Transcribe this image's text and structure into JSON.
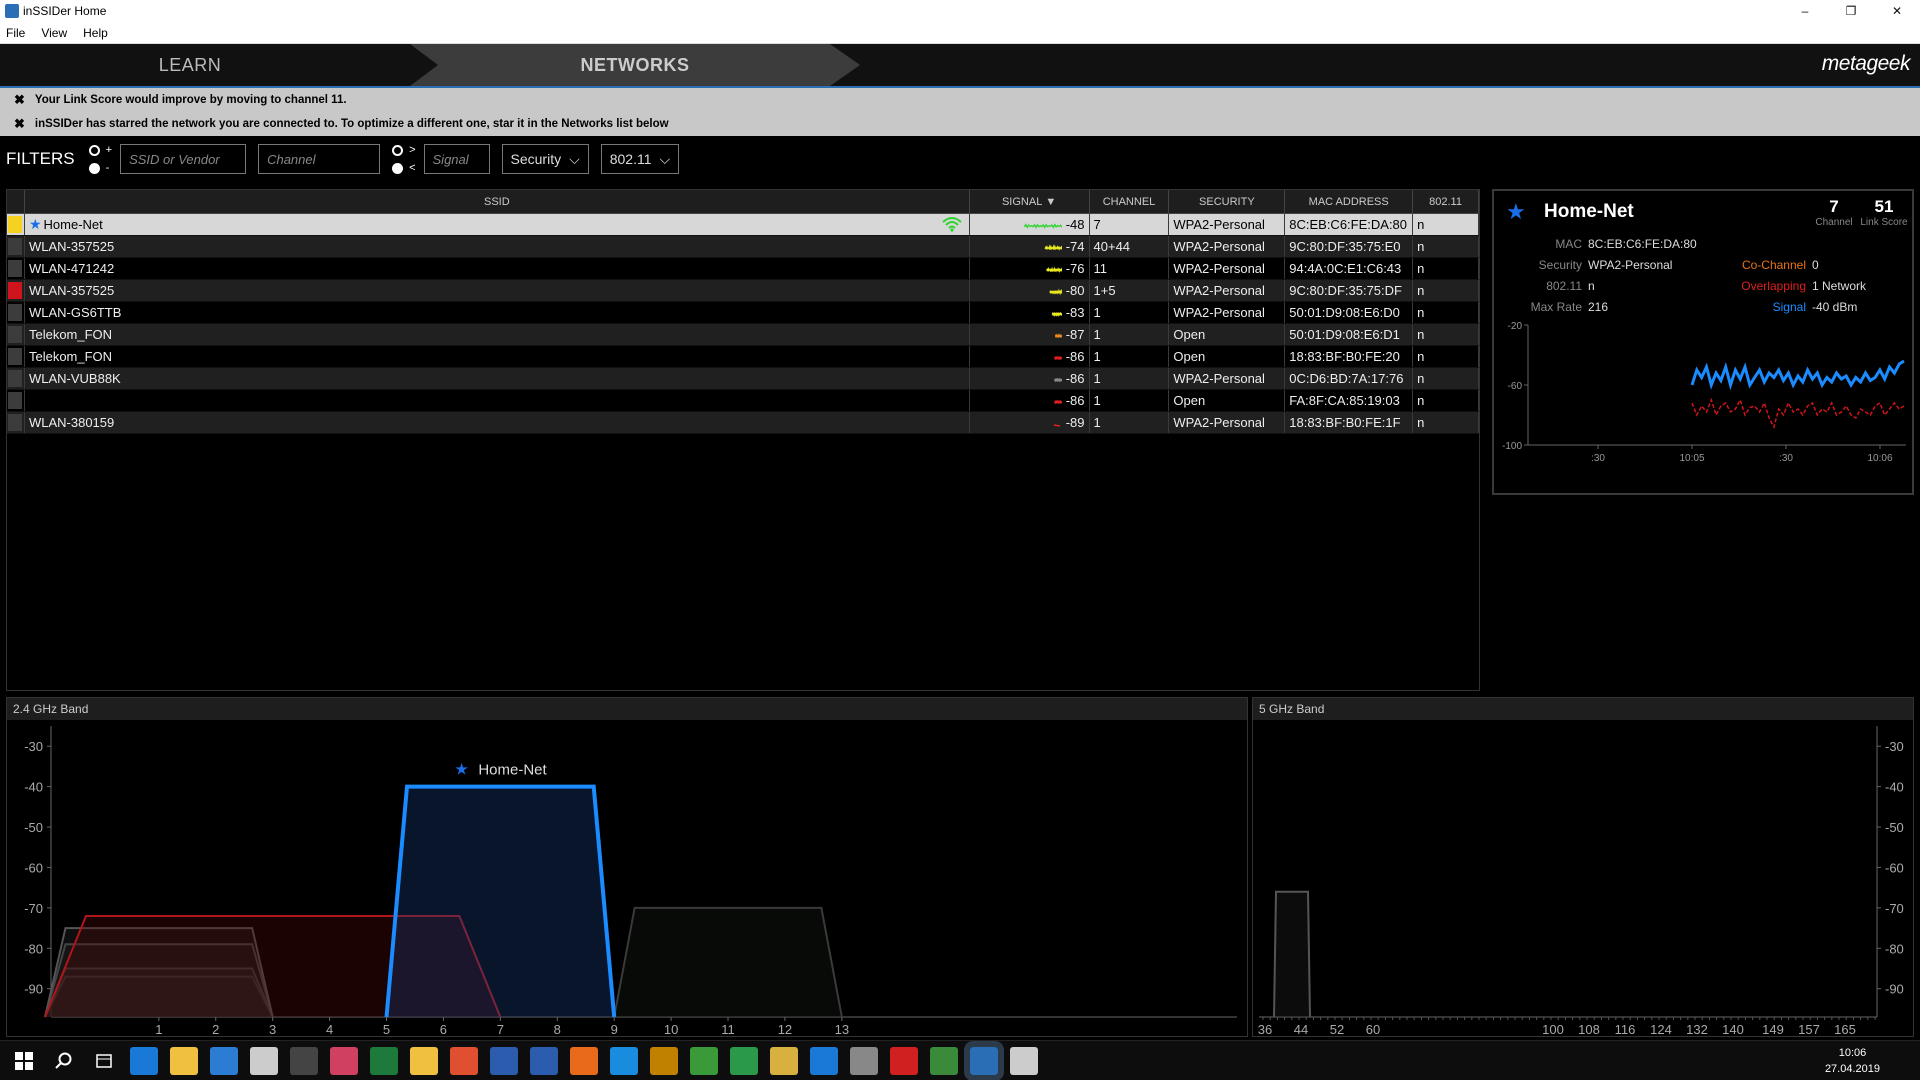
{
  "window": {
    "title": "inSSIDer Home",
    "controls": {
      "minimize": "–",
      "restore": "❐",
      "close": "✕"
    }
  },
  "menu": {
    "items": [
      "File",
      "View",
      "Help"
    ]
  },
  "nav": {
    "learn_label": "LEARN",
    "networks_label": "NETWORKS",
    "logo_text": "metageek"
  },
  "messages": [
    "Your Link Score would improve by moving to channel 11.",
    "inSSIDer has starred the network you are connected to. To optimize a different one, star it in the Networks list below"
  ],
  "filters": {
    "label": "FILTERS",
    "ssid_placeholder": "SSID or Vendor",
    "channel_placeholder": "Channel",
    "signal_placeholder": "Signal",
    "security_label": "Security",
    "standard_label": "802.11",
    "plus": "+",
    "minus": "-",
    "gt": ">",
    "lt": "<"
  },
  "table": {
    "headers": {
      "ssid": "SSID",
      "signal": "SIGNAL",
      "channel": "CHANNEL",
      "security": "SECURITY",
      "mac": "MAC ADDRESS",
      "standard": "802.11"
    },
    "rows": [
      {
        "color": "#f4d21f",
        "ssid": "Home-Net",
        "starred": true,
        "signal": "-48",
        "channel": "7",
        "security": "WPA2-Personal",
        "mac": "8C:EB:C6:FE:DA:80",
        "standard": "n",
        "spark_color": "#2bd42b"
      },
      {
        "color": "#3c3c3c",
        "ssid": "WLAN-357525",
        "starred": false,
        "signal": "-74",
        "channel": "40+44",
        "security": "WPA2-Personal",
        "mac": "9C:80:DF:35:75:E0",
        "standard": "n",
        "spark_color": "#e8e820"
      },
      {
        "color": "#3c3c3c",
        "ssid": "WLAN-471242",
        "starred": false,
        "signal": "-76",
        "channel": "11",
        "security": "WPA2-Personal",
        "mac": "94:4A:0C:E1:C6:43",
        "standard": "n",
        "spark_color": "#e8e820"
      },
      {
        "color": "#d0141c",
        "ssid": "WLAN-357525",
        "starred": false,
        "signal": "-80",
        "channel": "1+5",
        "security": "WPA2-Personal",
        "mac": "9C:80:DF:35:75:DF",
        "standard": "n",
        "spark_color": "#e8e820"
      },
      {
        "color": "#3c3c3c",
        "ssid": "WLAN-GS6TTB",
        "starred": false,
        "signal": "-83",
        "channel": "1",
        "security": "WPA2-Personal",
        "mac": "50:01:D9:08:E6:D0",
        "standard": "n",
        "spark_color": "#e8e820"
      },
      {
        "color": "#3c3c3c",
        "ssid": "Telekom_FON",
        "starred": false,
        "signal": "-87",
        "channel": "1",
        "security": "Open",
        "mac": "50:01:D9:08:E6:D1",
        "standard": "n",
        "spark_color": "#e88a20"
      },
      {
        "color": "#3c3c3c",
        "ssid": "Telekom_FON",
        "starred": false,
        "signal": "-86",
        "channel": "1",
        "security": "Open",
        "mac": "18:83:BF:B0:FE:20",
        "standard": "n",
        "spark_color": "#e02020"
      },
      {
        "color": "#3c3c3c",
        "ssid": "WLAN-VUB88K",
        "starred": false,
        "signal": "-86",
        "channel": "1",
        "security": "WPA2-Personal",
        "mac": "0C:D6:BD:7A:17:76",
        "standard": "n",
        "spark_color": "#888888"
      },
      {
        "color": "#3c3c3c",
        "ssid": "",
        "starred": false,
        "signal": "-86",
        "channel": "1",
        "security": "Open",
        "mac": "FA:8F:CA:85:19:03",
        "standard": "n",
        "spark_color": "#e02020"
      },
      {
        "color": "#3c3c3c",
        "ssid": "WLAN-380159",
        "starred": false,
        "signal": "-89",
        "channel": "1",
        "security": "WPA2-Personal",
        "mac": "18:83:BF:B0:FE:1F",
        "standard": "n",
        "spark_color": "#e02020"
      }
    ]
  },
  "details": {
    "ssid": "Home-Net",
    "channel_value": "7",
    "channel_label": "Channel",
    "link_score_value": "51",
    "link_score_label": "Link Score",
    "mac_label": "MAC",
    "mac_value": "8C:EB:C6:FE:DA:80",
    "security_label": "Security",
    "security_value": "WPA2-Personal",
    "std_label": "802.11",
    "std_value": "n",
    "max_rate_label": "Max Rate",
    "max_rate_value": "216",
    "cochannel_label": "Co-Channel",
    "cochannel_value": "0",
    "overlapping_label": "Overlapping",
    "overlapping_value": "1 Network",
    "signal_label": "Signal",
    "signal_value": "-40 dBm",
    "colors": {
      "cochannel": "#e8741a",
      "overlapping": "#e02020",
      "signal": "#1a8cff"
    }
  },
  "chart_data": [
    {
      "type": "line",
      "title": "",
      "x_ticks": [
        ":30",
        "10:05",
        ":30",
        "10:06"
      ],
      "y_ticks": [
        "-20",
        "-60",
        "-100"
      ],
      "ylim": [
        -100,
        -20
      ],
      "series": [
        {
          "color": "#1a8cff",
          "values": [
            -60,
            -50,
            -55,
            -48,
            -60,
            -52,
            -57,
            -48,
            -60,
            -50,
            -56,
            -48,
            -60,
            -55,
            -50,
            -58,
            -52,
            -55,
            -50,
            -57,
            -52,
            -60,
            -54,
            -58,
            -50,
            -56,
            -52,
            -60,
            -55,
            -58,
            -52,
            -56,
            -54,
            -60,
            -55,
            -58,
            -52,
            -57,
            -55,
            -50,
            -56,
            -48,
            -52,
            -46,
            -44
          ]
        },
        {
          "color": "#d0141c",
          "values": [
            -72,
            -80,
            -74,
            -78,
            -70,
            -80,
            -74,
            -72,
            -78,
            -76,
            -70,
            -80,
            -75,
            -74,
            -78,
            -72,
            -82,
            -88,
            -76,
            -80,
            -72,
            -78,
            -76,
            -80,
            -74,
            -72,
            -80,
            -76,
            -78,
            -72,
            -80,
            -78,
            -74,
            -80,
            -82,
            -76,
            -78,
            -80,
            -74,
            -72,
            -80,
            -76,
            -72,
            -76,
            -74
          ]
        }
      ],
      "grid": false
    },
    {
      "type": "area",
      "title": "2.4 GHz Band",
      "x_ticks": [
        "1",
        "2",
        "3",
        "4",
        "5",
        "6",
        "7",
        "8",
        "9",
        "10",
        "11",
        "12",
        "13"
      ],
      "y_ticks": [
        "-30",
        "-40",
        "-50",
        "-60",
        "-70",
        "-80",
        "-90"
      ],
      "ylim": [
        -97,
        -25
      ],
      "xlim": [
        -1.0,
        16.0
      ],
      "tick_colors": [
        "#d0141c",
        "#888",
        "#888",
        "#d0141c",
        "#d0141c",
        "#888",
        "#d0141c",
        "#888",
        "#1a8cff",
        "#d0141c",
        "#888",
        "#888",
        "#888"
      ],
      "series": [
        {
          "name": "Home-Net",
          "ranges": [
            5,
            9
          ],
          "peak": -40,
          "edge": -97,
          "stroke": "#1a8cff",
          "fill": "rgba(26,60,120,0.35)",
          "width": 4,
          "starred": true
        },
        {
          "ranges": [
            -1,
            7
          ],
          "peak": -72,
          "edge": -97,
          "stroke": "#b0151c",
          "fill": "rgba(80,10,10,0.35)",
          "width": 2
        },
        {
          "ranges": [
            -1,
            3
          ],
          "peak": -75,
          "edge": -97,
          "stroke": "#555",
          "fill": "rgba(40,40,40,0.35)",
          "width": 2
        },
        {
          "ranges": [
            -1,
            3
          ],
          "peak": -79,
          "edge": -97,
          "stroke": "#555",
          "fill": "rgba(40,40,40,0.3)",
          "width": 2
        },
        {
          "ranges": [
            -1,
            3
          ],
          "peak": -85,
          "edge": -97,
          "stroke": "#555",
          "fill": "rgba(40,40,40,0.3)",
          "width": 2
        },
        {
          "ranges": [
            -1,
            3
          ],
          "peak": -87,
          "edge": -97,
          "stroke": "#555",
          "fill": "rgba(40,40,40,0.3)",
          "width": 2
        },
        {
          "ranges": [
            9,
            13
          ],
          "peak": -70,
          "edge": -97,
          "stroke": "#3a3a3a",
          "fill": "rgba(20,30,20,0.35)",
          "width": 2
        }
      ]
    },
    {
      "type": "area",
      "title": "5 GHz Band",
      "x_ticks": [
        "36",
        "44",
        "52",
        "60",
        "100",
        "108",
        "116",
        "124",
        "132",
        "140",
        "149",
        "157",
        "165"
      ],
      "y_ticks": [
        "-30",
        "-40",
        "-50",
        "-60",
        "-70",
        "-80",
        "-90"
      ],
      "ylim": [
        -97,
        -25
      ],
      "series": [
        {
          "ranges": [
            38,
            46
          ],
          "peak": -66,
          "edge": -97,
          "stroke": "#555",
          "fill": "rgba(40,40,40,0.3)",
          "width": 2
        }
      ]
    }
  ],
  "taskbar": {
    "icons": [
      "windows-start-icon",
      "search-icon",
      "task-view-icon",
      "edge-icon",
      "explorer-icon",
      "store-icon",
      "settings-icon",
      "calculator-icon",
      "app-icon",
      "excel-icon",
      "folder-icon",
      "app-icon",
      "app-icon",
      "word-icon",
      "firefox-icon",
      "app-icon",
      "app-icon",
      "app-icon",
      "app-icon",
      "app-icon",
      "ie-icon",
      "app-icon",
      "app-icon",
      "app-icon",
      "inssider-icon",
      "app-icon"
    ],
    "time": "10:06",
    "date": "27.04.2019"
  }
}
